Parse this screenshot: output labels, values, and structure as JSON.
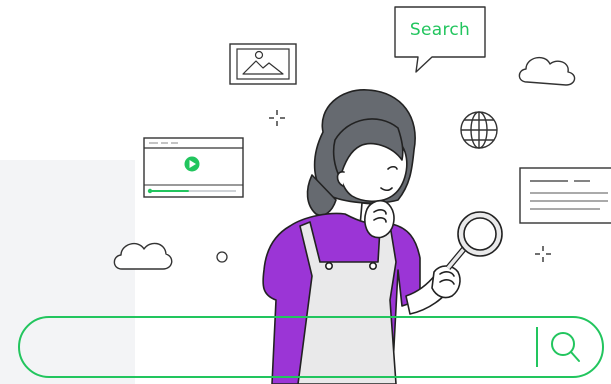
{
  "speech_bubble": {
    "label": "Search"
  },
  "search": {
    "placeholder": "",
    "value": ""
  },
  "colors": {
    "accent": "#22c55e",
    "line": "#222222",
    "shirt": "#9b35d6",
    "hair": "#666a70",
    "skin": "#ffffff",
    "panel": "#f3f4f6"
  },
  "icons": {
    "image": "image-icon",
    "video": "video-player-icon",
    "globe": "globe-icon",
    "document": "document-icon",
    "cloud": "cloud-icon",
    "sparkle": "sparkle-icon",
    "magnifier": "magnifying-glass-icon",
    "search": "search-icon"
  },
  "video_player": {
    "progress": 0.45
  }
}
